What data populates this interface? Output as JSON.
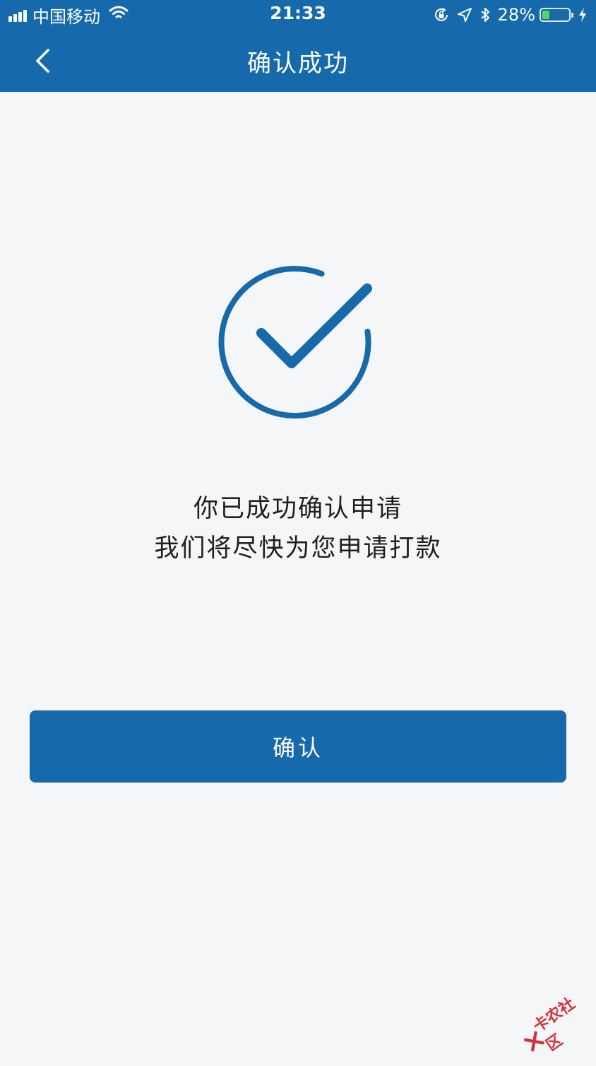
{
  "status_bar": {
    "carrier": "中国移动",
    "time": "21:33",
    "battery_percent": "28%",
    "battery_level": 0.28,
    "battery_color": "#4cd964"
  },
  "nav": {
    "title": "确认成功",
    "back_icon": "chevron-left-icon"
  },
  "main": {
    "icon": "check-circle-icon",
    "message_line1": "你已成功确认申请",
    "message_line2": "我们将尽快为您申请打款",
    "confirm_label": "确认"
  },
  "watermark": {
    "text": "卡农社区"
  },
  "colors": {
    "brand": "#166aab",
    "background": "#f4f6f8",
    "text": "#1f1f1f"
  }
}
